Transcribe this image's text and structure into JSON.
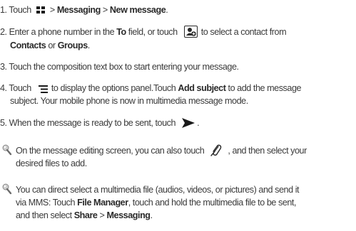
{
  "steps": [
    {
      "num": "1.",
      "pre": " Touch",
      "mid1": "> ",
      "bold1": "Messaging",
      "mid2": " > ",
      "bold2": "New message",
      "post": "."
    },
    {
      "num": "2.",
      "pre": " Enter a phone number in the ",
      "bold1": "To",
      "mid1": " field, or touch",
      "mid2": "to select a contact from"
    },
    {
      "bold1": "Contacts",
      "mid1": " or ",
      "bold2": "Groups",
      "post": "."
    },
    {
      "num": "3.",
      "text": " Touch the composition text box to start entering your message."
    },
    {
      "num": "4.",
      "pre": " Touch",
      "mid1": "to display the options panel.Touch ",
      "bold1": "Add subject",
      "post": " to add the message"
    },
    {
      "text": "subject. Your mobile phone is now in multimedia message mode."
    },
    {
      "num": "5.",
      "pre": " When the message is ready to be sent, touch",
      "post": "."
    }
  ],
  "notes": [
    {
      "l1a": "On the message editing screen, you can also touch",
      "l1b": ", and then select your",
      "l2": "desired files to add."
    },
    {
      "l1": "You can direct select a multimedia file (audios, videos, or pictures) and send it",
      "l2a": "via MMS: Touch ",
      "l2b": "File Manager",
      "l2c": ", touch and hold the multimedia file to be sent,",
      "l3a": "and then select ",
      "l3b": "Share",
      "l3c": " > ",
      "l3d": "Messaging",
      "l3e": "."
    }
  ],
  "icons": [
    "apps-grid-icon",
    "add-contact-icon",
    "menu-icon",
    "send-arrow-icon",
    "lightbulb-note-icon",
    "paperclip-icon"
  ]
}
